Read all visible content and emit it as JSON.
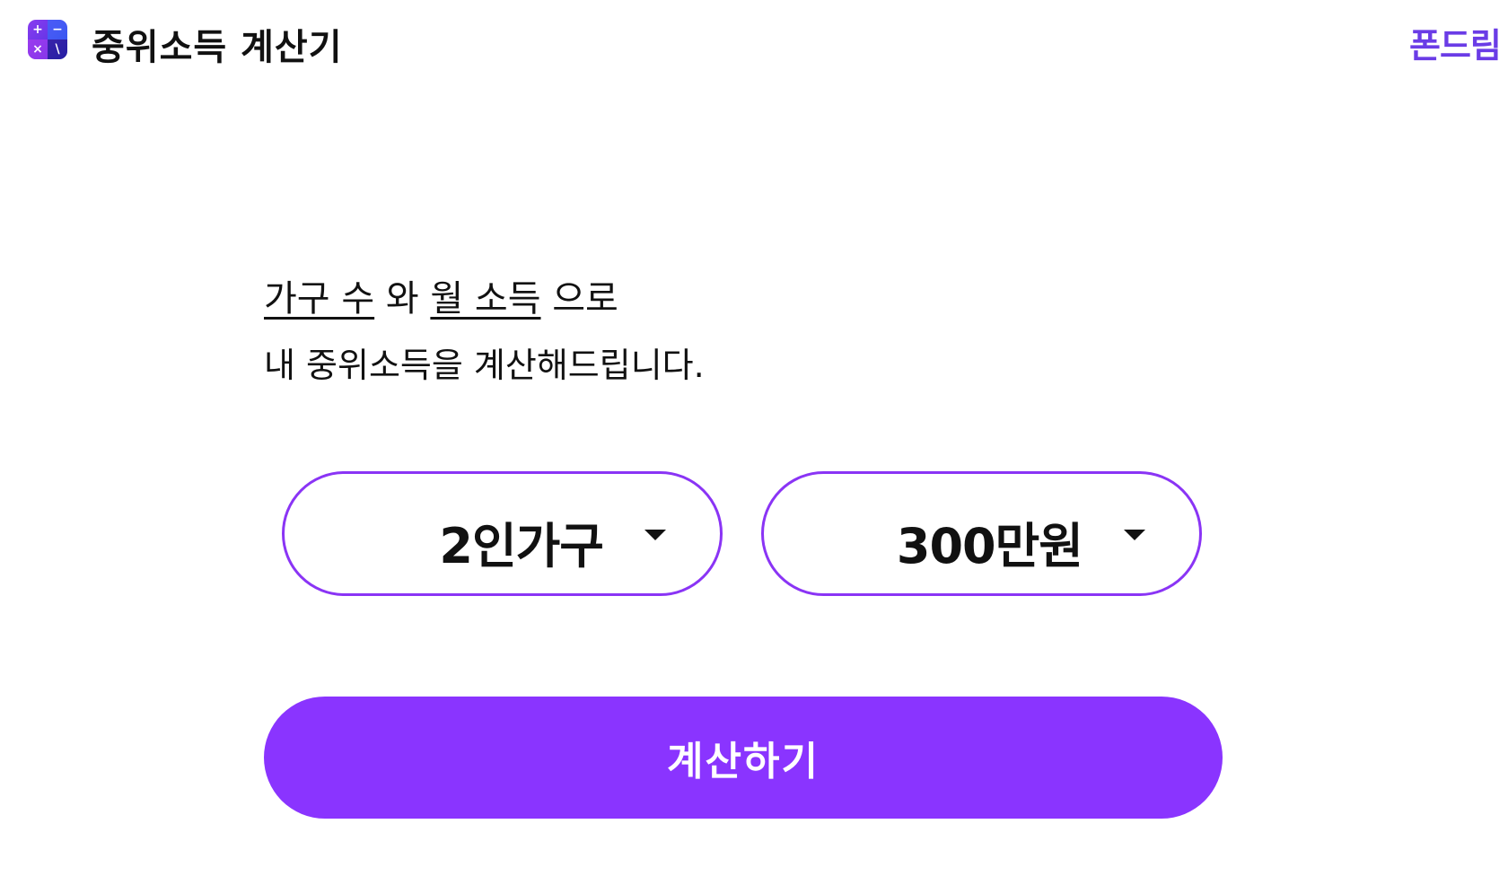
{
  "header": {
    "icon": "calculator-icon",
    "icon_symbols": [
      "+",
      "−",
      "×",
      "\\"
    ],
    "title": "중위소득 계산기",
    "brand": "폰드림"
  },
  "intro": {
    "line1": {
      "household_count": "가구 수",
      "and": "와",
      "monthly_income": "월 소득",
      "with": "으로"
    },
    "line2": "내 중위소득을 계산해드립니다."
  },
  "form": {
    "household_select": {
      "value": "2인가구"
    },
    "income_select": {
      "value": "300만원"
    },
    "submit_label": "계산하기"
  },
  "colors": {
    "accent": "#8a34ff",
    "border": "#8a34f5",
    "brand": "#6a3ce6",
    "text": "#111111",
    "background": "#ffffff"
  }
}
